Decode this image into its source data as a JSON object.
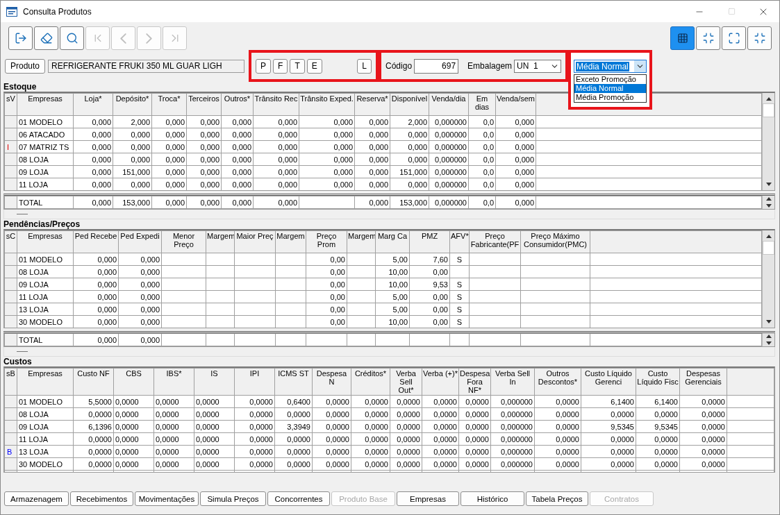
{
  "window": {
    "title": "Consulta Produtos"
  },
  "toolbar_left": [
    {
      "kind": "exit",
      "disabled": false
    },
    {
      "kind": "clear",
      "disabled": false
    },
    {
      "kind": "search",
      "disabled": false
    },
    {
      "kind": "first",
      "disabled": true
    },
    {
      "kind": "prev",
      "disabled": true
    },
    {
      "kind": "next",
      "disabled": true
    },
    {
      "kind": "last",
      "disabled": true
    }
  ],
  "toolbar_right": [
    {
      "kind": "grid",
      "selected": true
    },
    {
      "kind": "collapse",
      "selected": false
    },
    {
      "kind": "expand",
      "selected": false
    },
    {
      "kind": "collapse",
      "selected": false
    }
  ],
  "product": {
    "button": "Produto",
    "value": "REFRIGERANTE FRUKI 350 ML GUAR LIGH"
  },
  "price_buttons": {
    "highlighted": true,
    "left": [
      "P",
      "F",
      "T",
      "E"
    ],
    "right": "L"
  },
  "code_group": {
    "highlighted": true,
    "code_label": "Código",
    "code_value": "697",
    "pack_label": "Embalagem",
    "pack_value": "UN  1"
  },
  "average_select": {
    "highlighted": true,
    "value": "Média Normal",
    "expanded": true,
    "options": [
      {
        "label": "Exceto Promoção",
        "selected": false
      },
      {
        "label": "Média Normal",
        "selected": true
      },
      {
        "label": "Média Promoção",
        "selected": false
      }
    ]
  },
  "sections": [
    {
      "title": "Estoque",
      "columns": [
        "sV",
        "Empresas",
        "Loja*",
        "Depósito*",
        "Troca*",
        "Terceiros",
        "Outros*",
        "Trânsito Rec",
        "Trânsito Exped.",
        "Reserva*",
        "Disponível",
        "Venda/dia",
        "Em dias",
        "Venda/sem"
      ],
      "rows": [
        {
          "cells": [
            "",
            "01 MODELO",
            "0,000",
            "2,000",
            "0,000",
            "0,000",
            "0,000",
            "0,000",
            "0,000",
            "0,000",
            "2,000",
            "0,000000",
            "0,0",
            "0,000"
          ]
        },
        {
          "cells": [
            "",
            "06 ATACADO",
            "0,000",
            "0,000",
            "0,000",
            "0,000",
            "0,000",
            "0,000",
            "0,000",
            "0,000",
            "0,000",
            "0,000000",
            "0,0",
            "0,000"
          ]
        },
        {
          "color": "#e00000",
          "cells": [
            "I",
            "07 MATRIZ TS",
            "0,000",
            "0,000",
            "0,000",
            "0,000",
            "0,000",
            "0,000",
            "0,000",
            "0,000",
            "0,000",
            "0,000000",
            "0,0",
            "0,000"
          ]
        },
        {
          "cells": [
            "",
            "08 LOJA",
            "0,000",
            "0,000",
            "0,000",
            "0,000",
            "0,000",
            "0,000",
            "0,000",
            "0,000",
            "0,000",
            "0,000000",
            "0,0",
            "0,000"
          ]
        },
        {
          "cells": [
            "",
            "09 LOJA",
            "0,000",
            "151,000",
            "0,000",
            "0,000",
            "0,000",
            "0,000",
            "0,000",
            "0,000",
            "151,000",
            "0,000000",
            "0,0",
            "0,000"
          ]
        },
        {
          "cells": [
            "",
            "11 LOJA",
            "0,000",
            "0,000",
            "0,000",
            "0,000",
            "0,000",
            "0,000",
            "0,000",
            "0,000",
            "0,000",
            "0,000000",
            "0,0",
            "0,000"
          ]
        },
        {
          "kind": "total",
          "cells": [
            "",
            "TOTAL",
            "0,000",
            "153,000",
            "0,000",
            "0,000",
            "0,000",
            "0,000",
            "",
            "0,000",
            "153,000",
            "0,000000",
            "0,0",
            "0,000"
          ]
        }
      ]
    },
    {
      "title": "Pendências/Preços",
      "columns": [
        "sC",
        "Empresas",
        "Ped Recebe",
        "Ped Expedi",
        "Menor Preço",
        "Margem",
        "Maior Preç",
        "Margem",
        "Preço Prom",
        "Margem",
        "Marg Ca",
        "PMZ",
        "AFV*",
        "Preço Fabricante(PF",
        "Preço Máximo Consumidor(PMC)"
      ],
      "rows": [
        {
          "cells": [
            "",
            "01 MODELO",
            "0,000",
            "0,000",
            "",
            "",
            "",
            "",
            "0,00",
            "",
            "5,00",
            "7,60",
            "S",
            "",
            ""
          ]
        },
        {
          "cells": [
            "",
            "08 LOJA",
            "0,000",
            "0,000",
            "",
            "",
            "",
            "",
            "0,00",
            "",
            "10,00",
            "0,00",
            "",
            "",
            ""
          ]
        },
        {
          "cells": [
            "",
            "09 LOJA",
            "0,000",
            "0,000",
            "",
            "",
            "",
            "",
            "0,00",
            "",
            "10,00",
            "9,53",
            "S",
            "",
            ""
          ]
        },
        {
          "cells": [
            "",
            "11 LOJA",
            "0,000",
            "0,000",
            "",
            "",
            "",
            "",
            "0,00",
            "",
            "5,00",
            "0,00",
            "S",
            "",
            ""
          ]
        },
        {
          "cells": [
            "",
            "13 LOJA",
            "0,000",
            "0,000",
            "",
            "",
            "",
            "",
            "0,00",
            "",
            "5,00",
            "0,00",
            "S",
            "",
            ""
          ]
        },
        {
          "cells": [
            "",
            "30 MODELO",
            "0,000",
            "0,000",
            "",
            "",
            "",
            "",
            "0,00",
            "",
            "10,00",
            "0,00",
            "S",
            "",
            ""
          ]
        },
        {
          "kind": "total",
          "cells": [
            "",
            "TOTAL",
            "0,000",
            "0,000",
            "",
            "",
            "",
            "",
            "",
            "",
            "",
            "",
            "",
            "",
            ""
          ]
        }
      ]
    },
    {
      "title": "Custos",
      "columns": [
        "sB",
        "Empresas",
        "Custo NF",
        "CBS",
        "IBS*",
        "IS",
        "IPI",
        "ICMS ST",
        "Despesa N",
        "Créditos*",
        "Verba Sell Out*",
        "Verba (+)*",
        "Despesa Fora NF*",
        "Verba Sell In",
        "Outros Descontos*",
        "Custo Líquido Gerenci",
        "Custo Líquido Fisc",
        "Despesas Gerenciais"
      ],
      "rows": [
        {
          "cells": [
            "",
            "01 MODELO",
            "5,5000",
            "0,0000",
            "0,0000",
            "0,0000",
            "0,0000",
            "0,6400",
            "0,0000",
            "0,0000",
            "0,0000",
            "0,0000",
            "0,0000",
            "0,000000",
            "0,0000",
            "6,1400",
            "6,1400",
            "0,0000"
          ]
        },
        {
          "cells": [
            "",
            "08 LOJA",
            "0,0000",
            "0,0000",
            "0,0000",
            "0,0000",
            "0,0000",
            "0,0000",
            "0,0000",
            "0,0000",
            "0,0000",
            "0,0000",
            "0,0000",
            "0,000000",
            "0,0000",
            "0,0000",
            "0,0000",
            "0,0000"
          ]
        },
        {
          "cells": [
            "",
            "09 LOJA",
            "6,1396",
            "0,0000",
            "0,0000",
            "0,0000",
            "0,0000",
            "3,3949",
            "0,0000",
            "0,0000",
            "0,0000",
            "0,0000",
            "0,0000",
            "0,000000",
            "0,0000",
            "9,5345",
            "9,5345",
            "0,0000"
          ]
        },
        {
          "cells": [
            "",
            "11 LOJA",
            "0,0000",
            "0,0000",
            "0,0000",
            "0,0000",
            "0,0000",
            "0,0000",
            "0,0000",
            "0,0000",
            "0,0000",
            "0,0000",
            "0,0000",
            "0,000000",
            "0,0000",
            "0,0000",
            "0,0000",
            "0,0000"
          ]
        },
        {
          "color": "#0000ff",
          "cells": [
            "B",
            "13 LOJA",
            "0,0000",
            "0,0000",
            "0,0000",
            "0,0000",
            "0,0000",
            "0,0000",
            "0,0000",
            "0,0000",
            "0,0000",
            "0,0000",
            "0,0000",
            "0,000000",
            "0,0000",
            "0,0000",
            "0,0000",
            "0,0000"
          ]
        },
        {
          "cells": [
            "",
            "30 MODELO",
            "0,0000",
            "0,0000",
            "0,0000",
            "0,0000",
            "0,0000",
            "0,0000",
            "0,0000",
            "0,0000",
            "0,0000",
            "0,0000",
            "0,0000",
            "0,000000",
            "0,0000",
            "0,0000",
            "0,0000",
            "0,0000"
          ]
        }
      ]
    }
  ],
  "bottom_buttons": [
    {
      "label": "Armazenagem",
      "disabled": false
    },
    {
      "label": "Recebimentos",
      "disabled": false
    },
    {
      "label": "Movimentações",
      "disabled": false
    },
    {
      "label": "Simula Preços",
      "disabled": false
    },
    {
      "label": "Concorrentes",
      "disabled": false
    },
    {
      "label": "Produto Base",
      "disabled": true
    },
    {
      "label": "Empresas",
      "disabled": false
    },
    {
      "label": "Histórico",
      "disabled": false
    },
    {
      "label": "Tabela Preços",
      "disabled": false
    },
    {
      "label": "Contratos",
      "disabled": true
    }
  ]
}
